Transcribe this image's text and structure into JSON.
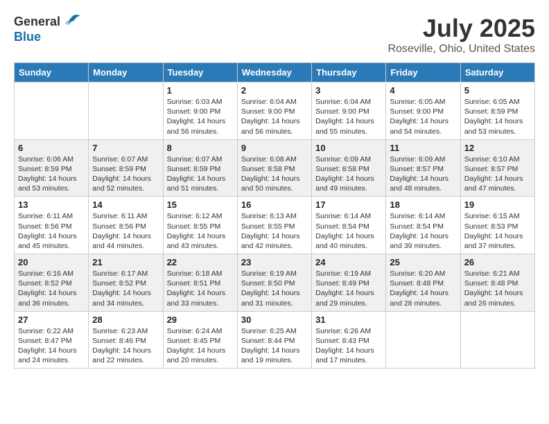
{
  "header": {
    "logo_general": "General",
    "logo_blue": "Blue",
    "month_year": "July 2025",
    "location": "Roseville, Ohio, United States"
  },
  "days_of_week": [
    "Sunday",
    "Monday",
    "Tuesday",
    "Wednesday",
    "Thursday",
    "Friday",
    "Saturday"
  ],
  "weeks": [
    [
      {
        "day": "",
        "info": ""
      },
      {
        "day": "",
        "info": ""
      },
      {
        "day": "1",
        "info": "Sunrise: 6:03 AM\nSunset: 9:00 PM\nDaylight: 14 hours and 56 minutes."
      },
      {
        "day": "2",
        "info": "Sunrise: 6:04 AM\nSunset: 9:00 PM\nDaylight: 14 hours and 56 minutes."
      },
      {
        "day": "3",
        "info": "Sunrise: 6:04 AM\nSunset: 9:00 PM\nDaylight: 14 hours and 55 minutes."
      },
      {
        "day": "4",
        "info": "Sunrise: 6:05 AM\nSunset: 9:00 PM\nDaylight: 14 hours and 54 minutes."
      },
      {
        "day": "5",
        "info": "Sunrise: 6:05 AM\nSunset: 8:59 PM\nDaylight: 14 hours and 53 minutes."
      }
    ],
    [
      {
        "day": "6",
        "info": "Sunrise: 6:06 AM\nSunset: 8:59 PM\nDaylight: 14 hours and 53 minutes."
      },
      {
        "day": "7",
        "info": "Sunrise: 6:07 AM\nSunset: 8:59 PM\nDaylight: 14 hours and 52 minutes."
      },
      {
        "day": "8",
        "info": "Sunrise: 6:07 AM\nSunset: 8:59 PM\nDaylight: 14 hours and 51 minutes."
      },
      {
        "day": "9",
        "info": "Sunrise: 6:08 AM\nSunset: 8:58 PM\nDaylight: 14 hours and 50 minutes."
      },
      {
        "day": "10",
        "info": "Sunrise: 6:09 AM\nSunset: 8:58 PM\nDaylight: 14 hours and 49 minutes."
      },
      {
        "day": "11",
        "info": "Sunrise: 6:09 AM\nSunset: 8:57 PM\nDaylight: 14 hours and 48 minutes."
      },
      {
        "day": "12",
        "info": "Sunrise: 6:10 AM\nSunset: 8:57 PM\nDaylight: 14 hours and 47 minutes."
      }
    ],
    [
      {
        "day": "13",
        "info": "Sunrise: 6:11 AM\nSunset: 8:56 PM\nDaylight: 14 hours and 45 minutes."
      },
      {
        "day": "14",
        "info": "Sunrise: 6:11 AM\nSunset: 8:56 PM\nDaylight: 14 hours and 44 minutes."
      },
      {
        "day": "15",
        "info": "Sunrise: 6:12 AM\nSunset: 8:55 PM\nDaylight: 14 hours and 43 minutes."
      },
      {
        "day": "16",
        "info": "Sunrise: 6:13 AM\nSunset: 8:55 PM\nDaylight: 14 hours and 42 minutes."
      },
      {
        "day": "17",
        "info": "Sunrise: 6:14 AM\nSunset: 8:54 PM\nDaylight: 14 hours and 40 minutes."
      },
      {
        "day": "18",
        "info": "Sunrise: 6:14 AM\nSunset: 8:54 PM\nDaylight: 14 hours and 39 minutes."
      },
      {
        "day": "19",
        "info": "Sunrise: 6:15 AM\nSunset: 8:53 PM\nDaylight: 14 hours and 37 minutes."
      }
    ],
    [
      {
        "day": "20",
        "info": "Sunrise: 6:16 AM\nSunset: 8:52 PM\nDaylight: 14 hours and 36 minutes."
      },
      {
        "day": "21",
        "info": "Sunrise: 6:17 AM\nSunset: 8:52 PM\nDaylight: 14 hours and 34 minutes."
      },
      {
        "day": "22",
        "info": "Sunrise: 6:18 AM\nSunset: 8:51 PM\nDaylight: 14 hours and 33 minutes."
      },
      {
        "day": "23",
        "info": "Sunrise: 6:19 AM\nSunset: 8:50 PM\nDaylight: 14 hours and 31 minutes."
      },
      {
        "day": "24",
        "info": "Sunrise: 6:19 AM\nSunset: 8:49 PM\nDaylight: 14 hours and 29 minutes."
      },
      {
        "day": "25",
        "info": "Sunrise: 6:20 AM\nSunset: 8:48 PM\nDaylight: 14 hours and 28 minutes."
      },
      {
        "day": "26",
        "info": "Sunrise: 6:21 AM\nSunset: 8:48 PM\nDaylight: 14 hours and 26 minutes."
      }
    ],
    [
      {
        "day": "27",
        "info": "Sunrise: 6:22 AM\nSunset: 8:47 PM\nDaylight: 14 hours and 24 minutes."
      },
      {
        "day": "28",
        "info": "Sunrise: 6:23 AM\nSunset: 8:46 PM\nDaylight: 14 hours and 22 minutes."
      },
      {
        "day": "29",
        "info": "Sunrise: 6:24 AM\nSunset: 8:45 PM\nDaylight: 14 hours and 20 minutes."
      },
      {
        "day": "30",
        "info": "Sunrise: 6:25 AM\nSunset: 8:44 PM\nDaylight: 14 hours and 19 minutes."
      },
      {
        "day": "31",
        "info": "Sunrise: 6:26 AM\nSunset: 8:43 PM\nDaylight: 14 hours and 17 minutes."
      },
      {
        "day": "",
        "info": ""
      },
      {
        "day": "",
        "info": ""
      }
    ]
  ]
}
